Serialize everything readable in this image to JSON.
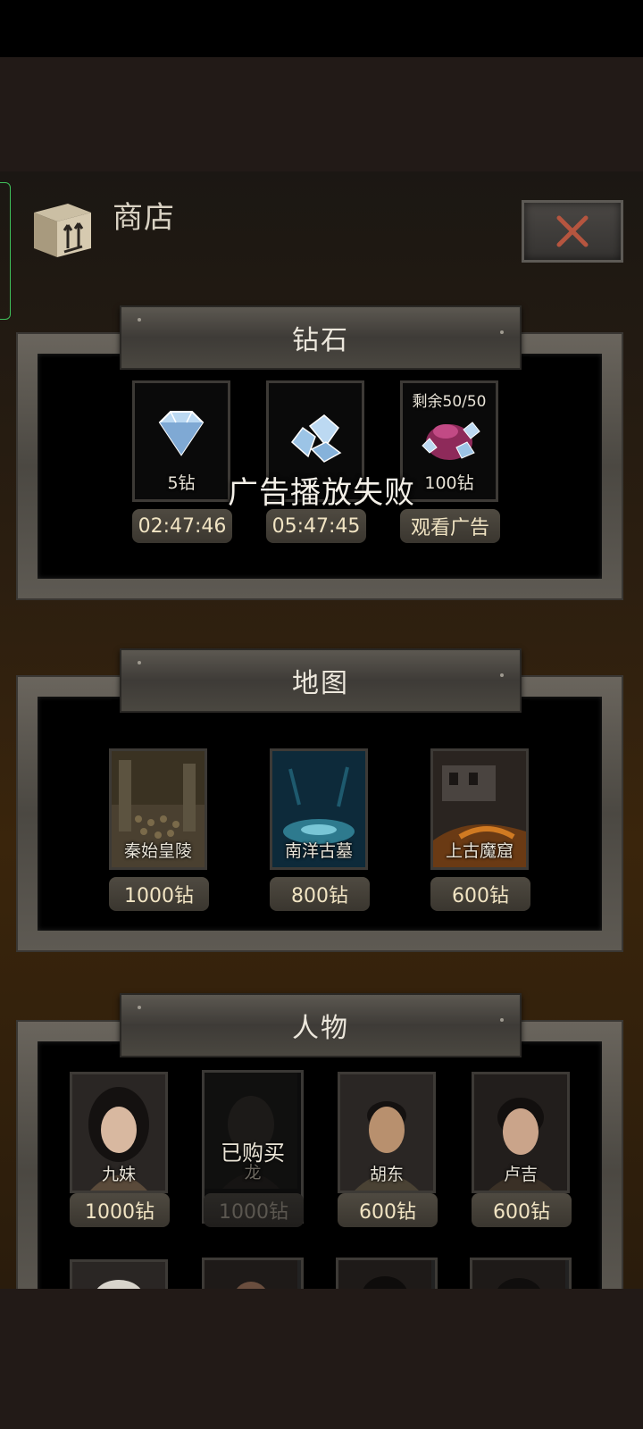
{
  "shop": {
    "title": "商店",
    "close_label": "×"
  },
  "toast": "广告播放失败",
  "diamond": {
    "title": "钻石",
    "items": [
      {
        "label": "5钻",
        "price": "02:47:46",
        "top": "",
        "icon": "diamond-icon"
      },
      {
        "label": "",
        "price": "05:47:45",
        "top": "",
        "icon": "diamond-pile-icon"
      },
      {
        "label": "100钻",
        "price": "观看广告",
        "top": "剩余50/50",
        "icon": "diamond-bag-icon"
      }
    ]
  },
  "maps": {
    "title": "地图",
    "items": [
      {
        "label": "秦始皇陵",
        "price": "1000钻"
      },
      {
        "label": "南洋古墓",
        "price": "800钻"
      },
      {
        "label": "上古魔窟",
        "price": "600钻"
      }
    ]
  },
  "characters": {
    "title": "人物",
    "items": [
      {
        "label": "九妹",
        "price": "1000钻",
        "purchased": false
      },
      {
        "label": "龙",
        "price": "1000钻",
        "purchased": true,
        "purchased_label": "已购买"
      },
      {
        "label": "胡东",
        "price": "600钻",
        "purchased": false
      },
      {
        "label": "卢吉",
        "price": "600钻",
        "purchased": false
      }
    ]
  },
  "colors": {
    "accent": "#f1e4c3",
    "close_x": "#b5553f",
    "background": "#221a17"
  }
}
